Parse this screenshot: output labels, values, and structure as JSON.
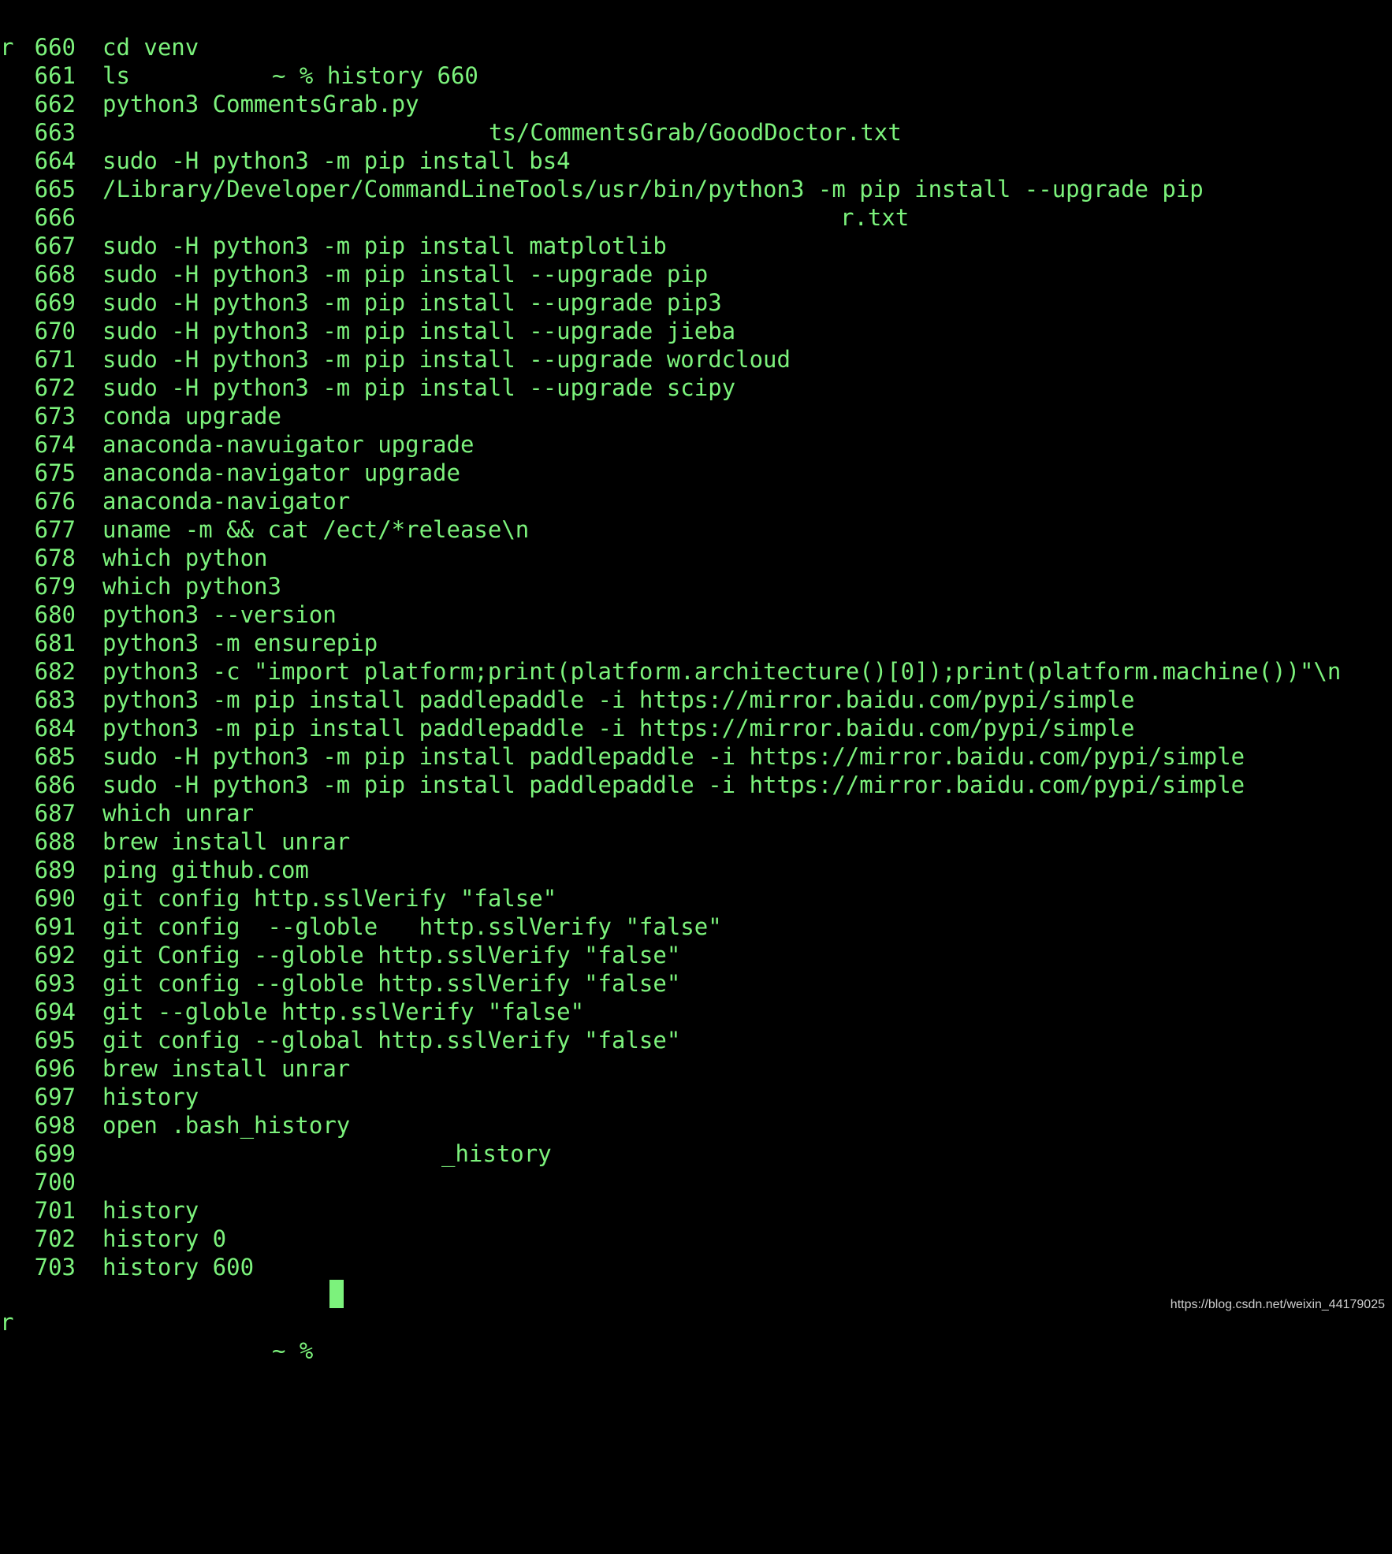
{
  "terminal": {
    "colors": {
      "background": "#000000",
      "text": "#7CF27C",
      "cursor": "#7CF27C"
    },
    "top_prompt": {
      "host_fragment": "r",
      "text": "~ % history 660"
    },
    "bottom_prompt": {
      "host_fragment": "r",
      "text": "~ %"
    },
    "history": [
      {
        "num": "660",
        "cmd": "cd venv"
      },
      {
        "num": "661",
        "cmd": "ls"
      },
      {
        "num": "662",
        "cmd": "python3 CommentsGrab.py"
      },
      {
        "num": "663",
        "cmd": "ts/CommentsGrab/GoodDoctor.txt"
      },
      {
        "num": "664",
        "cmd": "sudo -H python3 -m pip install bs4"
      },
      {
        "num": "665",
        "cmd": "/Library/Developer/CommandLineTools/usr/bin/python3 -m pip install --upgrade pip"
      },
      {
        "num": "666",
        "cmd": "r.txt"
      },
      {
        "num": "667",
        "cmd": "sudo -H python3 -m pip install matplotlib"
      },
      {
        "num": "668",
        "cmd": "sudo -H python3 -m pip install --upgrade pip"
      },
      {
        "num": "669",
        "cmd": "sudo -H python3 -m pip install --upgrade pip3"
      },
      {
        "num": "670",
        "cmd": "sudo -H python3 -m pip install --upgrade jieba"
      },
      {
        "num": "671",
        "cmd": "sudo -H python3 -m pip install --upgrade wordcloud"
      },
      {
        "num": "672",
        "cmd": "sudo -H python3 -m pip install --upgrade scipy"
      },
      {
        "num": "673",
        "cmd": "conda upgrade"
      },
      {
        "num": "674",
        "cmd": "anaconda-navuigator upgrade"
      },
      {
        "num": "675",
        "cmd": "anaconda-navigator upgrade"
      },
      {
        "num": "676",
        "cmd": "anaconda-navigator"
      },
      {
        "num": "677",
        "cmd": "uname -m && cat /ect/*release\\n"
      },
      {
        "num": "678",
        "cmd": "which python"
      },
      {
        "num": "679",
        "cmd": "which python3"
      },
      {
        "num": "680",
        "cmd": "python3 --version"
      },
      {
        "num": "681",
        "cmd": "python3 -m ensurepip"
      },
      {
        "num": "682",
        "cmd": "python3 -c \"import platform;print(platform.architecture()[0]);print(platform.machine())\"\\n"
      },
      {
        "num": "683",
        "cmd": "python3 -m pip install paddlepaddle -i https://mirror.baidu.com/pypi/simple"
      },
      {
        "num": "684",
        "cmd": "python3 -m pip install paddlepaddle -i https://mirror.baidu.com/pypi/simple"
      },
      {
        "num": "685",
        "cmd": "sudo -H python3 -m pip install paddlepaddle -i https://mirror.baidu.com/pypi/simple"
      },
      {
        "num": "686",
        "cmd": "sudo -H python3 -m pip install paddlepaddle -i https://mirror.baidu.com/pypi/simple"
      },
      {
        "num": "687",
        "cmd": "which unrar"
      },
      {
        "num": "688",
        "cmd": "brew install unrar"
      },
      {
        "num": "689",
        "cmd": "ping github.com"
      },
      {
        "num": "690",
        "cmd": "git config http.sslVerify \"false\""
      },
      {
        "num": "691",
        "cmd": "git config  --globle   http.sslVerify \"false\""
      },
      {
        "num": "692",
        "cmd": "git Config --globle http.sslVerify \"false\""
      },
      {
        "num": "693",
        "cmd": "git config --globle http.sslVerify \"false\""
      },
      {
        "num": "694",
        "cmd": "git --globle http.sslVerify \"false\""
      },
      {
        "num": "695",
        "cmd": "git config --global http.sslVerify \"false\""
      },
      {
        "num": "696",
        "cmd": "brew install unrar"
      },
      {
        "num": "697",
        "cmd": "history"
      },
      {
        "num": "698",
        "cmd": "open .bash_history"
      },
      {
        "num": "699",
        "cmd": "_history"
      },
      {
        "num": "700",
        "cmd": ""
      },
      {
        "num": "701",
        "cmd": "history"
      },
      {
        "num": "702",
        "cmd": "history 0"
      },
      {
        "num": "703",
        "cmd": "history 600"
      }
    ]
  },
  "watermark": "https://blog.csdn.net/weixin_44179025"
}
